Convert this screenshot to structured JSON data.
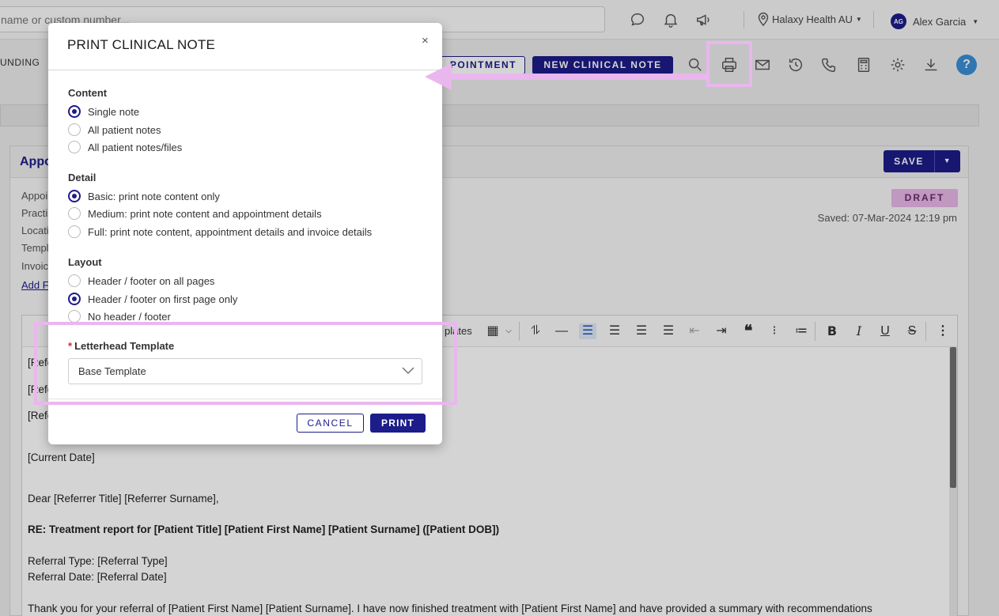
{
  "topbar": {
    "search_placeholder": "name or custom number...",
    "location": "Halaxy Health AU",
    "user_initials": "AG",
    "user_name": "Alex Garcia"
  },
  "secondbar": {
    "funding_label": "UNDING",
    "appointment_button": "POINTMENT",
    "new_note_button": "NEW CLINICAL NOTE",
    "help": "?"
  },
  "card": {
    "title": "Appo",
    "info_labels": [
      "Appoi",
      "Practi",
      "Locati",
      "Templ",
      "Invoic"
    ],
    "add_link": "Add F",
    "save_label": "SAVE",
    "status": "DRAFT",
    "saved_text": "Saved: 07-Mar-2024 12:19 pm"
  },
  "editor": {
    "toolbar_left": "I",
    "toolbar_templates": "plates",
    "lines": {
      "l1": "[Refe",
      "l2": "[Refe",
      "l3": "[Refe",
      "current_date": "[Current Date]",
      "dear": "Dear [Referrer Title] [Referrer Surname],",
      "re": "RE: Treatment report for [Patient Title] [Patient First Name] [Patient Surname] ([Patient DOB])",
      "ref_type": "Referral Type: [Referral Type]",
      "ref_date": "Referral Date: [Referral Date]",
      "thanks": "Thank you for your referral of [Patient First Name] [Patient Surname]. I have now finished treatment with [Patient First Name] and have provided a summary with recommendations"
    }
  },
  "modal": {
    "title": "PRINT CLINICAL NOTE",
    "close": "×",
    "content": {
      "label": "Content",
      "options": [
        "Single note",
        "All patient notes",
        "All patient notes/files"
      ],
      "selected": 0
    },
    "detail": {
      "label": "Detail",
      "options": [
        "Basic: print note content only",
        "Medium: print note content and appointment details",
        "Full: print note content, appointment details and invoice details"
      ],
      "selected": 0
    },
    "layout": {
      "label": "Layout",
      "options": [
        "Header / footer on all pages",
        "Header / footer on first page only",
        "No header / footer"
      ],
      "selected": 1
    },
    "letterhead": {
      "required_mark": "*",
      "label": "Letterhead Template",
      "value": "Base Template"
    },
    "cancel_label": "CANCEL",
    "print_label": "PRINT"
  },
  "colors": {
    "brand": "#1c1c8a",
    "highlight": "#e9b7ee",
    "draft_badge": "#e7b7e7",
    "help": "#3a8fd6"
  }
}
